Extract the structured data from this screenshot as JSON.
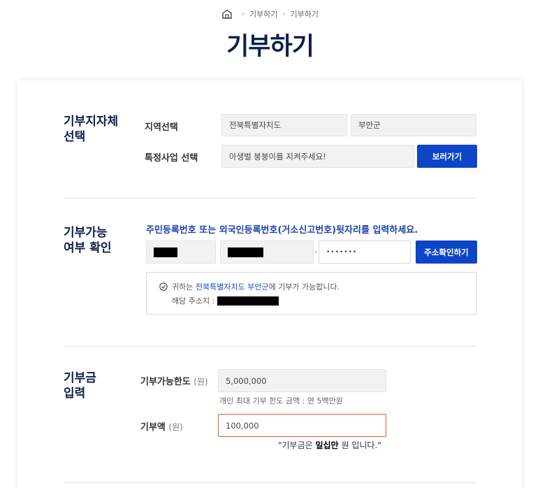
{
  "breadcrumb": {
    "items": [
      "기부하기",
      "기부하기"
    ]
  },
  "page": {
    "title": "기부하기"
  },
  "section1": {
    "title_line1": "기부지자체",
    "title_line2": "선택",
    "region_label": "지역선택",
    "region_value": "전북특별자치도",
    "district_value": "부안군",
    "project_label": "특정사업 선택",
    "project_value": "아생벌 붕붕이를 지켜주세요!",
    "view_button": "보러가기"
  },
  "section2": {
    "title_line1": "기부가능",
    "title_line2": "여부 확인",
    "notice": "주민등록번호 또는 외국인등록번호(거소신고번호)뒷자리를 입력하세요.",
    "dash": "-",
    "password_value": "•••••••",
    "address_button": "주소확인하기",
    "result_prefix": "귀하는",
    "result_region": "전북특별자치도 부안군",
    "result_suffix": "에 기부가 가능합니다.",
    "address_label": "해당 주소지 :"
  },
  "section3": {
    "title_line1": "기부금",
    "title_line2": "입력",
    "limit_label": "기부가능한도",
    "limit_unit": "(원)",
    "limit_value": "5,000,000",
    "limit_hint": "개인 최대 기부 한도 금액 : 연 5백만원",
    "amount_label": "기부액",
    "amount_unit": "(원)",
    "amount_value": "100,000",
    "amount_note_prefix": "\"기부금은",
    "amount_note_bold": "일십만",
    "amount_note_suffix": "원 입니다.\""
  },
  "colors": {
    "title": "#0f1f4d",
    "accent": "#0c46c7",
    "notice": "#1f3fae",
    "error_border": "#e0572e"
  }
}
